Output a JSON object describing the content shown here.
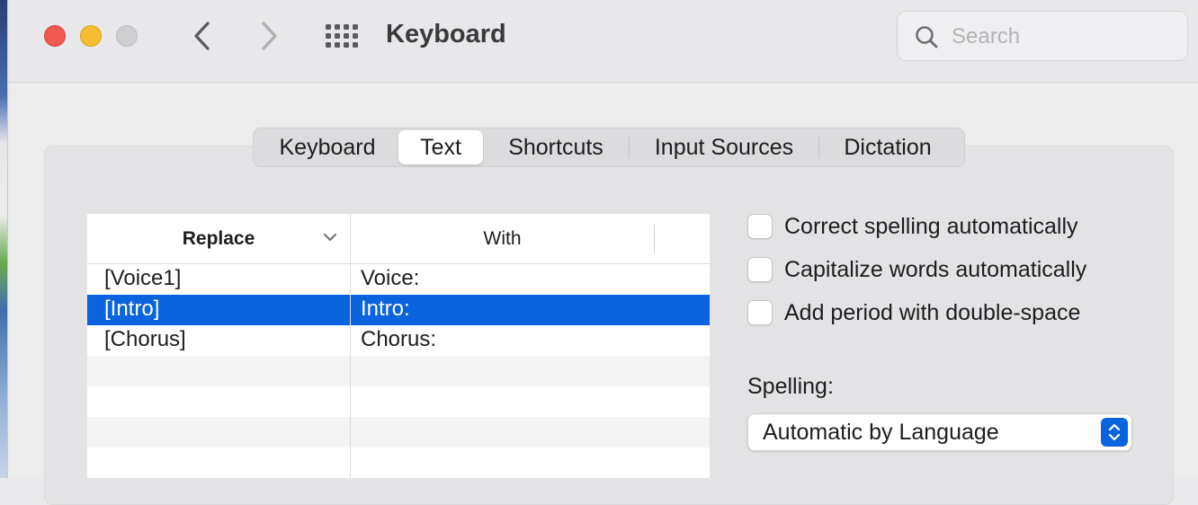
{
  "window": {
    "title": "Keyboard",
    "search_placeholder": "Search"
  },
  "tabs": [
    {
      "label": "Keyboard",
      "active": false
    },
    {
      "label": "Text",
      "active": true
    },
    {
      "label": "Shortcuts",
      "active": false
    },
    {
      "label": "Input Sources",
      "active": false
    },
    {
      "label": "Dictation",
      "active": false
    }
  ],
  "table": {
    "columns": [
      "Replace",
      "With"
    ],
    "rows": [
      {
        "replace": "[Voice1]",
        "with": "Voice:",
        "selected": false
      },
      {
        "replace": "[Intro]",
        "with": "Intro:",
        "selected": true
      },
      {
        "replace": "[Chorus]",
        "with": "Chorus:",
        "selected": false
      }
    ]
  },
  "options": [
    {
      "label": "Correct spelling automatically",
      "checked": false
    },
    {
      "label": "Capitalize words automatically",
      "checked": false
    },
    {
      "label": "Add period with double-space",
      "checked": false
    }
  ],
  "spelling": {
    "label": "Spelling:",
    "value": "Automatic by Language"
  },
  "colors": {
    "accent": "#0964de",
    "close": "#ee5a52",
    "minimize": "#f5bd2f",
    "zoom_inactive": "#cfcfd1"
  },
  "icons": {
    "back": "chevron-left-icon",
    "forward": "chevron-right-icon",
    "grid": "grid-icon",
    "search": "search-icon",
    "sort": "chevron-down-icon",
    "stepper": "up-down-chevron-icon"
  }
}
